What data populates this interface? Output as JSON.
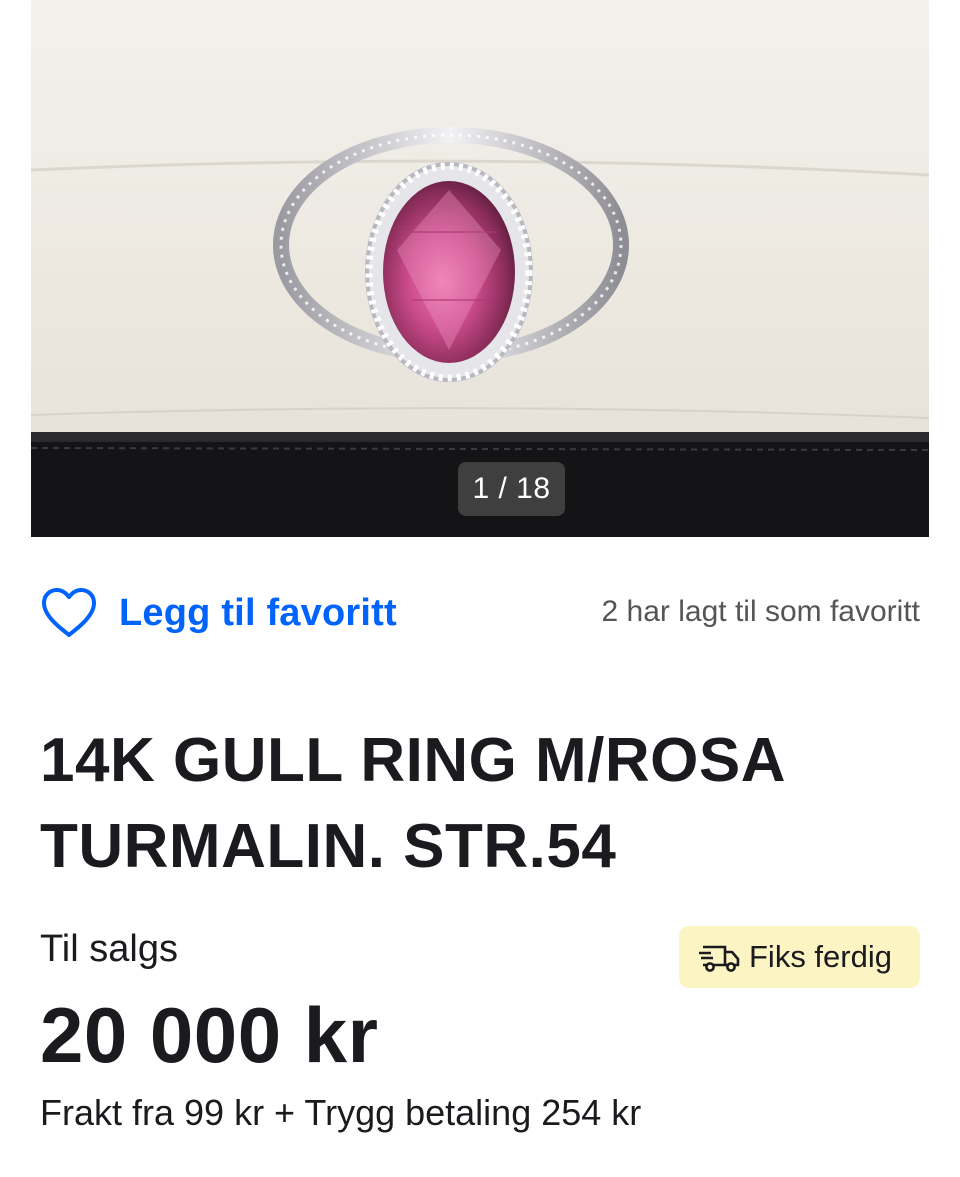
{
  "gallery": {
    "counter": "1 / 18"
  },
  "favorite": {
    "label": "Legg til favoritt",
    "count_text": "2 har lagt til som favoritt"
  },
  "listing": {
    "title": "14K GULL RING M/ROSA TURMALIN. STR.54",
    "status": "Til salgs",
    "price": "20 000 kr",
    "shipping": "Frakt fra 99 kr + Trygg betaling 254 kr",
    "badge": "Fiks ferdig"
  },
  "icons": {
    "favorite": "heart-outline-icon",
    "badge": "delivery-truck-icon"
  },
  "colors": {
    "link_blue": "#0063fb",
    "badge_bg": "#fdf4c4",
    "text": "#1b1b1f",
    "muted": "#555555"
  }
}
